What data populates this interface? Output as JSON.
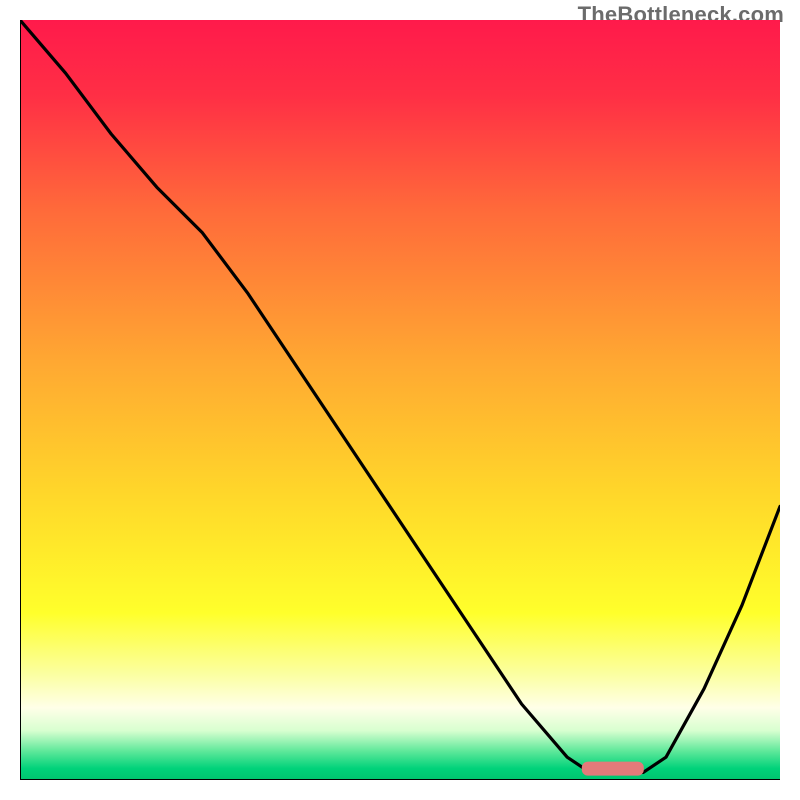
{
  "watermark": "TheBottleneck.com",
  "chart_data": {
    "type": "line",
    "title": "",
    "xlabel": "",
    "ylabel": "",
    "xlim": [
      0,
      100
    ],
    "ylim": [
      0,
      100
    ],
    "grid": false,
    "annotations": [
      {
        "type": "marker",
        "shape": "rounded-rect",
        "x": 78,
        "y": 1.5,
        "color": "#e47a7a"
      }
    ],
    "gradient_stops": [
      {
        "offset": 0.0,
        "color": "#ff1a4b"
      },
      {
        "offset": 0.1,
        "color": "#ff2f45"
      },
      {
        "offset": 0.25,
        "color": "#ff6a3a"
      },
      {
        "offset": 0.45,
        "color": "#ffa832"
      },
      {
        "offset": 0.62,
        "color": "#ffd62a"
      },
      {
        "offset": 0.78,
        "color": "#ffff2b"
      },
      {
        "offset": 0.86,
        "color": "#fbffa0"
      },
      {
        "offset": 0.905,
        "color": "#ffffe8"
      },
      {
        "offset": 0.935,
        "color": "#d8ffd0"
      },
      {
        "offset": 0.962,
        "color": "#5fe89a"
      },
      {
        "offset": 0.985,
        "color": "#00d27a"
      },
      {
        "offset": 1.0,
        "color": "#00c46e"
      }
    ],
    "series": [
      {
        "name": "bottleneck-curve",
        "color": "#000000",
        "x": [
          0,
          6,
          12,
          18,
          24,
          30,
          36,
          42,
          48,
          54,
          60,
          66,
          72,
          75,
          78,
          82,
          85,
          90,
          95,
          100
        ],
        "y": [
          100,
          93,
          85,
          78,
          72,
          64,
          55,
          46,
          37,
          28,
          19,
          10,
          3,
          1,
          1,
          1,
          3,
          12,
          23,
          36
        ]
      }
    ]
  }
}
